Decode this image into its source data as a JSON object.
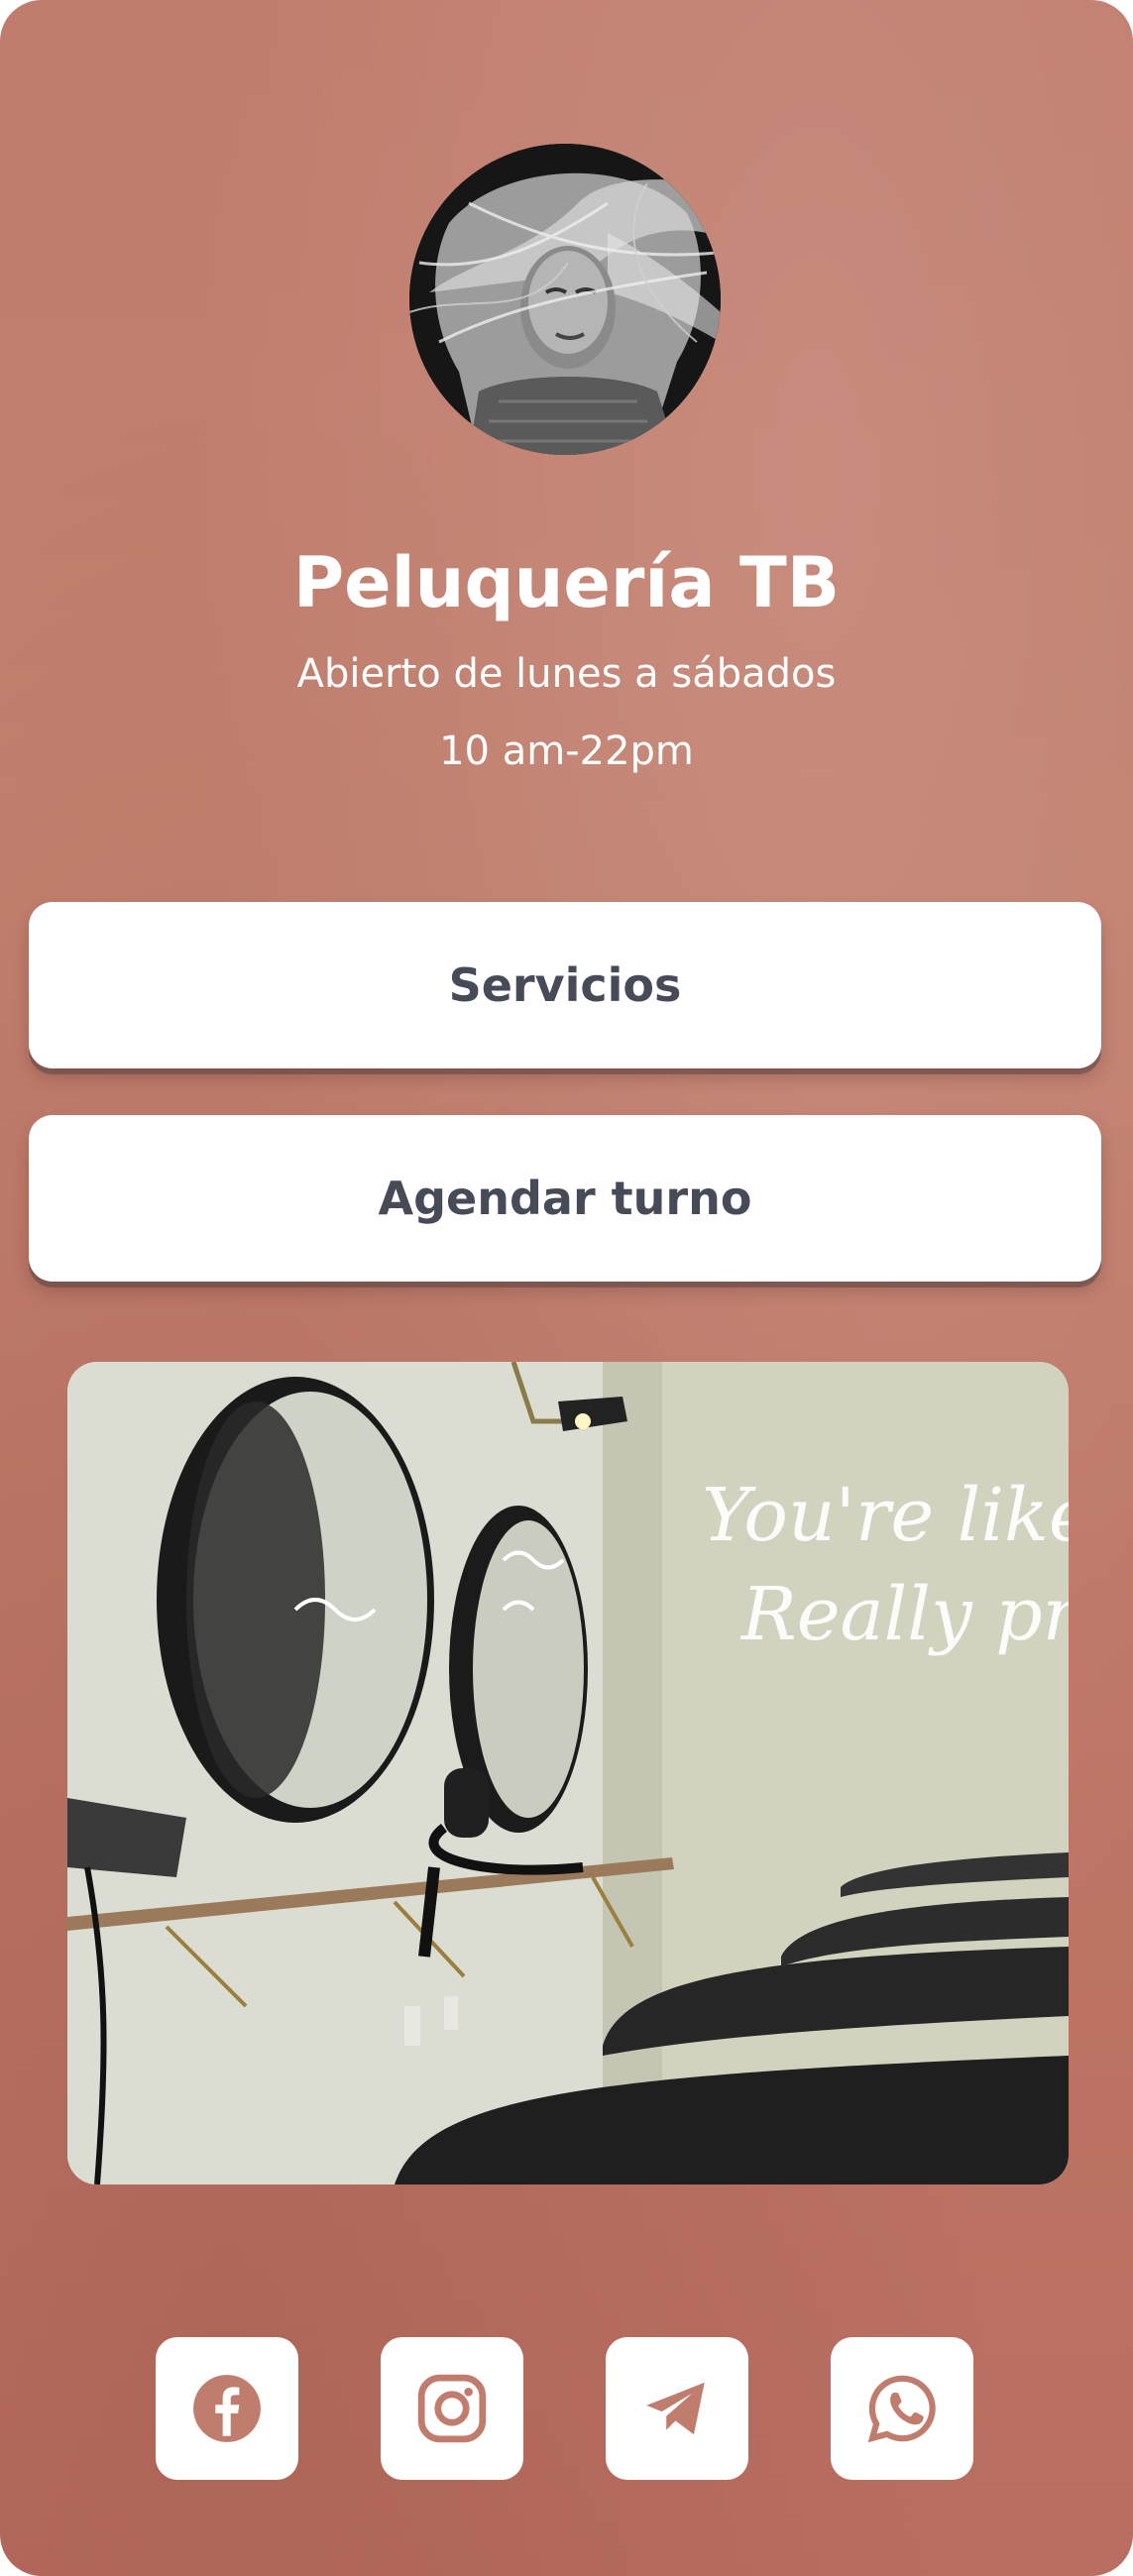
{
  "profile": {
    "title": "Peluquería TB",
    "subtitle_line1": "Abierto de lunes a sábados",
    "subtitle_line2": "10 am-22pm"
  },
  "buttons": {
    "services_label": "Servicios",
    "booking_label": "Agendar turno"
  },
  "colors": {
    "background": "#c07c6d",
    "button_text": "#474a57",
    "icon": "#c07c6d",
    "white": "#ffffff"
  },
  "social": [
    {
      "icon": "facebook-icon"
    },
    {
      "icon": "instagram-icon"
    },
    {
      "icon": "telegram-icon"
    },
    {
      "icon": "whatsapp-icon"
    }
  ],
  "photo": {
    "neon_line1": "You're like,",
    "neon_line2": "Really pretty"
  }
}
